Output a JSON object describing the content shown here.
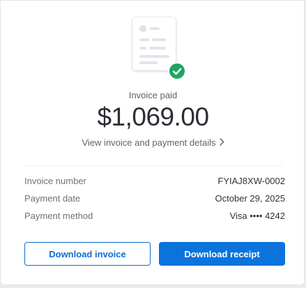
{
  "status": {
    "label": "Invoice paid",
    "amount": "$1,069.00",
    "details_link": "View invoice and payment details"
  },
  "details": [
    {
      "label": "Invoice number",
      "value": "FYIAJ8XW-0002"
    },
    {
      "label": "Payment date",
      "value": "October 29, 2025"
    },
    {
      "label": "Payment method",
      "value": "Visa •••• 4242"
    }
  ],
  "actions": {
    "download_invoice": "Download invoice",
    "download_receipt": "Download receipt"
  },
  "icons": {
    "document": "invoice-document-icon",
    "badge": "check-circle-icon",
    "chevron": "chevron-right-icon"
  },
  "colors": {
    "primary": "#0a73dc",
    "success": "#1fa463",
    "text_dark": "#2a2e33"
  }
}
